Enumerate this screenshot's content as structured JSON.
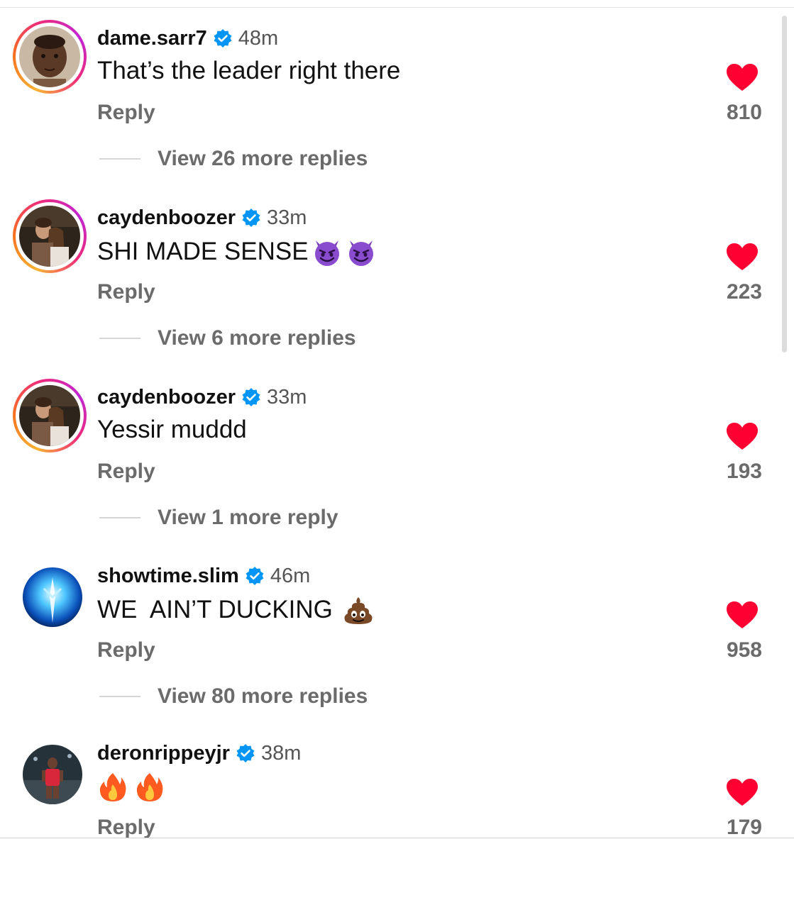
{
  "comments": [
    {
      "username": "dame.sarr7",
      "time": "48m",
      "text": "That’s the leader right there",
      "emoji": [],
      "reply_label": "Reply",
      "likes": "810",
      "view_replies": "View 26 more replies",
      "story_ring": true
    },
    {
      "username": "caydenboozer",
      "time": "33m",
      "text": "SHI MADE SENSE",
      "emoji": [
        "smiling-devil-icon",
        "smiling-devil-icon"
      ],
      "reply_label": "Reply",
      "likes": "223",
      "view_replies": "View 6 more replies",
      "story_ring": true
    },
    {
      "username": "caydenboozer",
      "time": "33m",
      "text": "Yessir muddd",
      "emoji": [],
      "reply_label": "Reply",
      "likes": "193",
      "view_replies": "View 1 more reply",
      "story_ring": true
    },
    {
      "username": "showtime.slim",
      "time": "46m",
      "text": "WE  AIN’T DUCKING ",
      "emoji": [
        "poop-icon"
      ],
      "reply_label": "Reply",
      "likes": "958",
      "view_replies": "View 80 more replies",
      "story_ring": false
    },
    {
      "username": "deronrippeyjr",
      "time": "38m",
      "text": "",
      "emoji": [
        "fire-icon",
        "fire-icon"
      ],
      "reply_label": "Reply",
      "likes": "179",
      "view_replies": "",
      "story_ring": false
    }
  ],
  "colors": {
    "heart": "#ff0033",
    "verified": "#0095f6",
    "muted_text": "#6b6b6b"
  },
  "icons": {
    "like": "heart-icon",
    "verified": "verified-badge-icon"
  }
}
